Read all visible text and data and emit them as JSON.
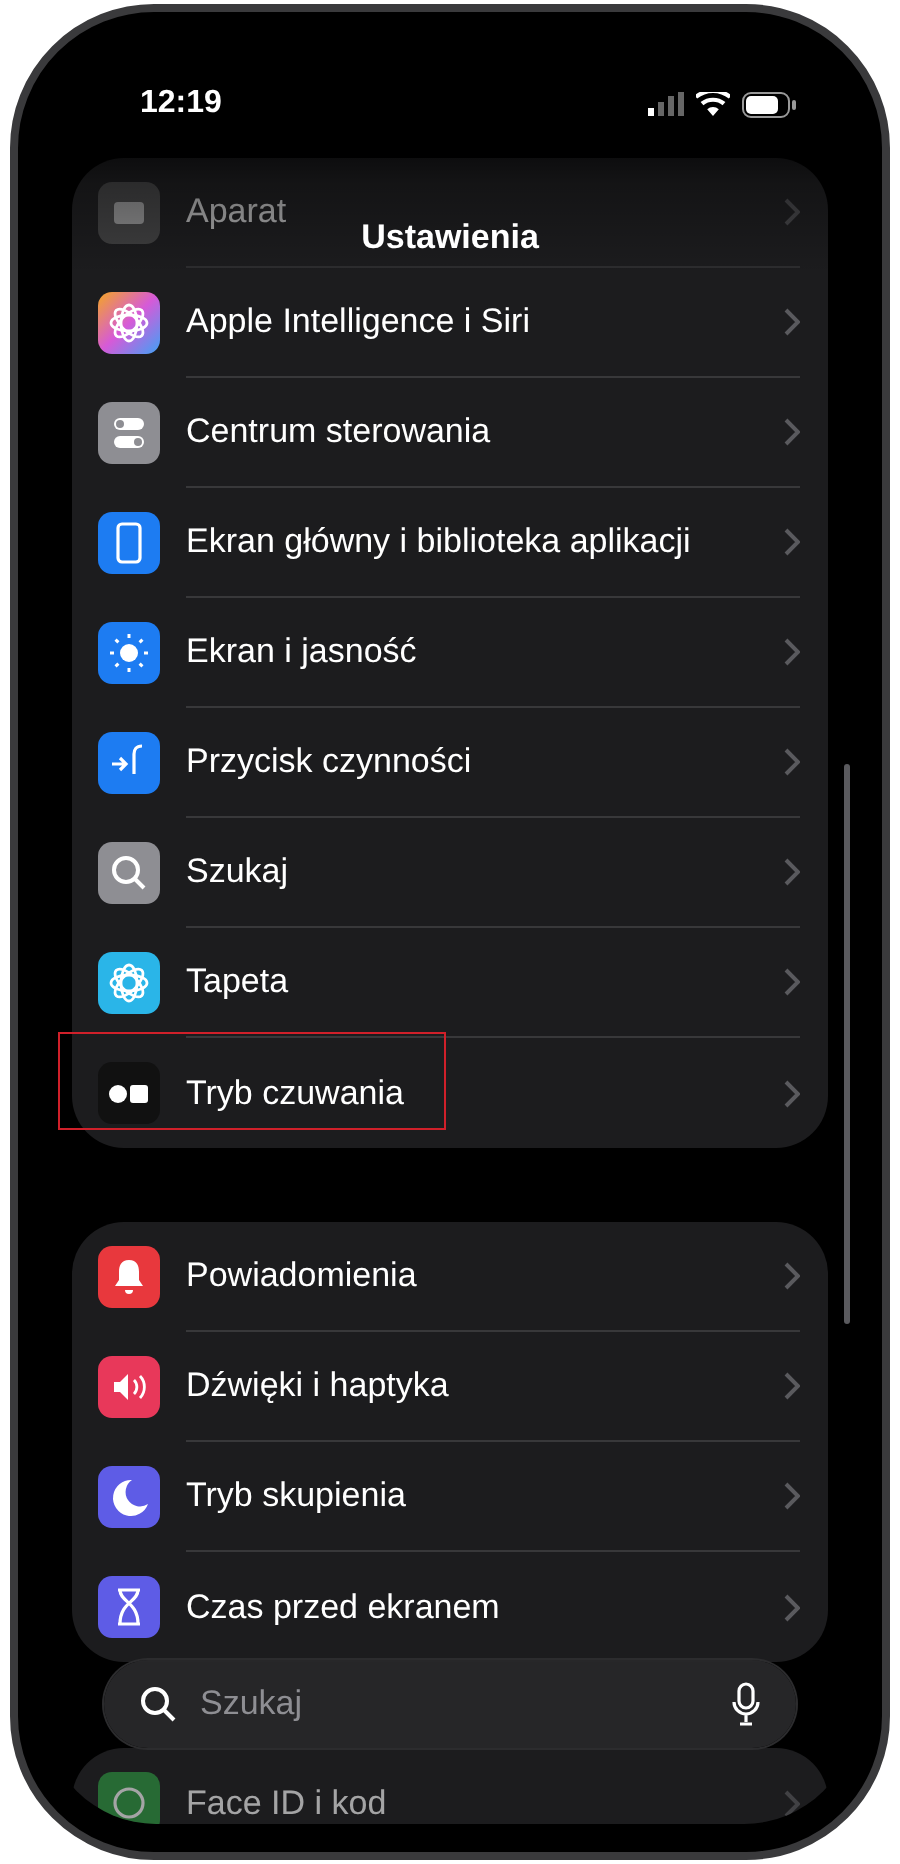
{
  "status_bar": {
    "time": "12:19"
  },
  "header": {
    "title": "Ustawienia"
  },
  "groups": [
    {
      "rows": [
        {
          "label": "Aparat",
          "faded": true,
          "highlighted": false
        },
        {
          "label": "Apple Intelligence i Siri",
          "faded": false,
          "highlighted": false
        },
        {
          "label": "Centrum sterowania",
          "faded": false,
          "highlighted": false
        },
        {
          "label": "Ekran główny i biblioteka aplikacji",
          "faded": false,
          "highlighted": false
        },
        {
          "label": "Ekran i jasność",
          "faded": false,
          "highlighted": false
        },
        {
          "label": "Przycisk czynności",
          "faded": false,
          "highlighted": false
        },
        {
          "label": "Szukaj",
          "faded": false,
          "highlighted": false
        },
        {
          "label": "Tapeta",
          "faded": false,
          "highlighted": false
        },
        {
          "label": "Tryb czuwania",
          "faded": false,
          "highlighted": true
        }
      ]
    },
    {
      "rows": [
        {
          "label": "Powiadomienia",
          "faded": false,
          "highlighted": false
        },
        {
          "label": "Dźwięki i haptyka",
          "faded": false,
          "highlighted": false
        },
        {
          "label": "Tryb skupienia",
          "faded": false,
          "highlighted": false
        },
        {
          "label": "Czas przed ekranem",
          "faded": false,
          "highlighted": false
        }
      ]
    },
    {
      "rows": [
        {
          "label": "Face ID i kod",
          "faded": true,
          "highlighted": false
        }
      ]
    }
  ],
  "search": {
    "placeholder": "Szukaj"
  }
}
